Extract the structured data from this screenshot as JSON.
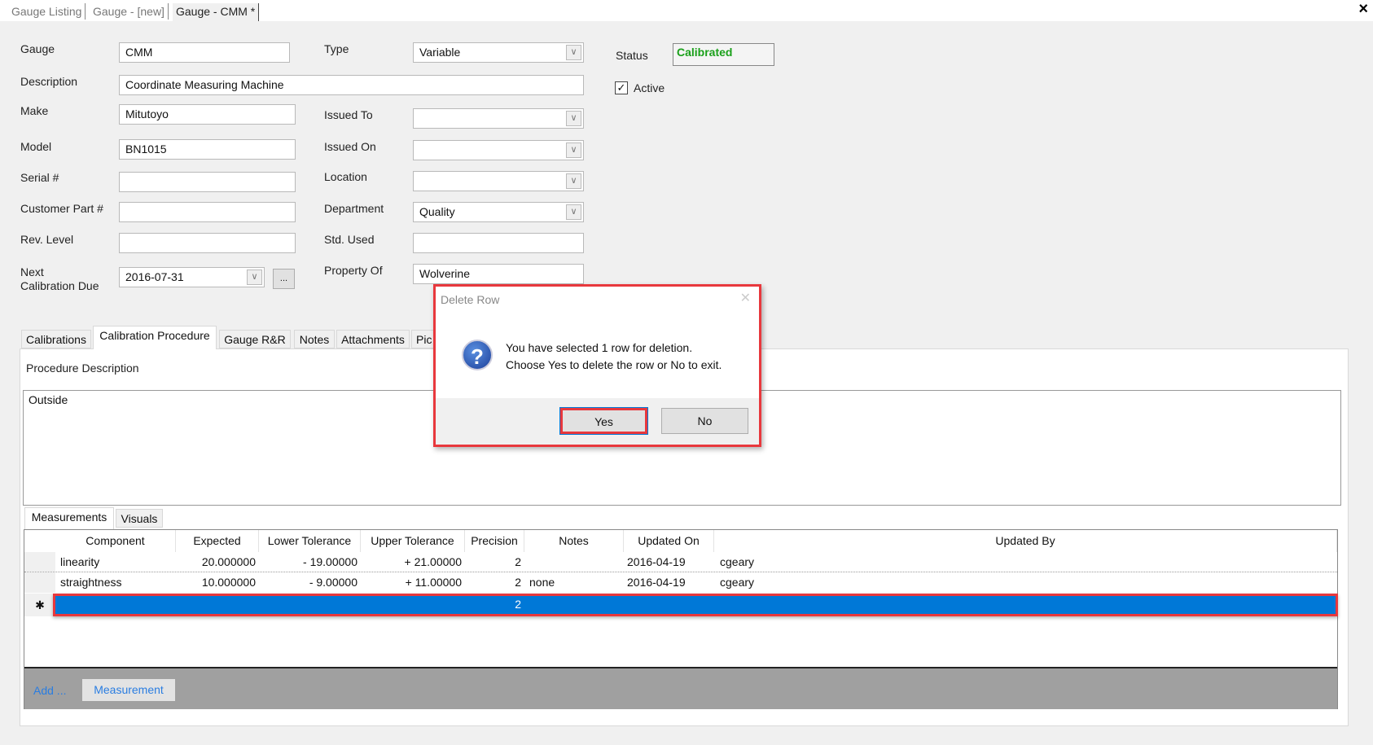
{
  "doc_tabs": [
    "Gauge Listing",
    "Gauge - [new]",
    "Gauge - CMM *"
  ],
  "close_label": "×",
  "form": {
    "gauge": {
      "label": "Gauge",
      "value": "CMM"
    },
    "description": {
      "label": "Description",
      "value": "Coordinate Measuring Machine"
    },
    "make": {
      "label": "Make",
      "value": "Mitutoyo"
    },
    "model": {
      "label": "Model",
      "value": "BN1015"
    },
    "serial": {
      "label": "Serial #",
      "value": ""
    },
    "customer_part": {
      "label": "Customer Part #",
      "value": ""
    },
    "rev_level": {
      "label": "Rev. Level",
      "value": ""
    },
    "next_cal_label_1": "Next",
    "next_cal_label_2": "Calibration Due",
    "next_cal_value": "2016-07-31",
    "ellipsis": "...",
    "type": {
      "label": "Type",
      "value": "Variable"
    },
    "issued_to": {
      "label": "Issued To",
      "value": ""
    },
    "issued_on": {
      "label": "Issued On",
      "value": ""
    },
    "location": {
      "label": "Location",
      "value": ""
    },
    "department": {
      "label": "Department",
      "value": "Quality"
    },
    "std_used": {
      "label": "Std. Used",
      "value": ""
    },
    "property_of": {
      "label": "Property Of",
      "value": "Wolverine"
    },
    "status": {
      "label": "Status",
      "value": "Calibrated",
      "color": "#1aa01a"
    },
    "active": {
      "label": "Active",
      "checked": true
    }
  },
  "tabs": [
    "Calibrations",
    "Calibration Procedure",
    "Gauge R&R",
    "Notes",
    "Attachments",
    "Pic"
  ],
  "procedure": {
    "label": "Procedure Description",
    "text": "Outside"
  },
  "sub_tabs": [
    "Measurements",
    "Visuals"
  ],
  "grid": {
    "columns": [
      "Component",
      "Expected",
      "Lower Tolerance",
      "Upper Tolerance",
      "Precision",
      "Notes",
      "Updated On",
      "Updated By"
    ],
    "rows": [
      [
        "linearity",
        "20.000000",
        "- 19.00000",
        "+ 21.00000",
        "2",
        "",
        "2016-04-19",
        "cgeary"
      ],
      [
        "straightness",
        "10.000000",
        "- 9.00000",
        "+ 11.00000",
        "2",
        "none",
        "2016-04-19",
        "cgeary"
      ]
    ],
    "new_row_marker": "✱",
    "new_row_precision": "2",
    "selected_color": "#0078d7"
  },
  "footer": {
    "add_label": "Add ...",
    "measurement_label": "Measurement"
  },
  "dialog": {
    "title": "Delete Row",
    "line1": "You have selected 1 row for deletion.",
    "line2": "Choose Yes to delete the row or No to exit.",
    "yes": "Yes",
    "no": "No",
    "icon": "question-icon"
  }
}
